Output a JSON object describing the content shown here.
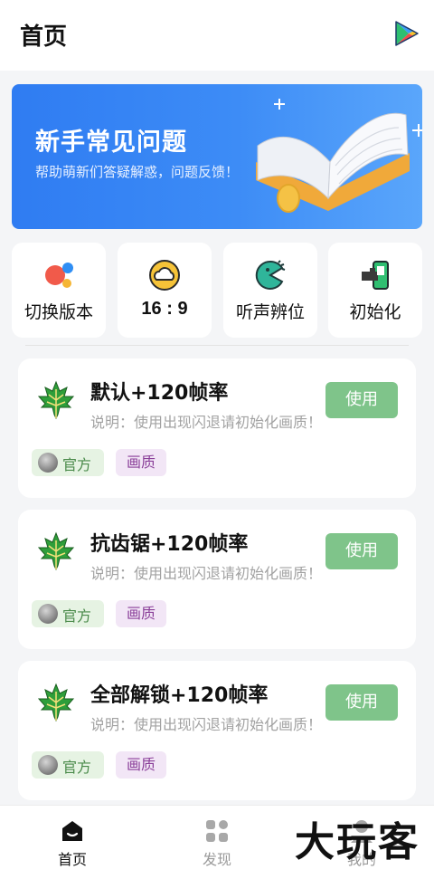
{
  "header": {
    "title": "首页",
    "store_icon": "play-store-icon"
  },
  "banner": {
    "title": "新手常见问题",
    "subtitle": "帮助萌新们答疑解惑，问题反馈！"
  },
  "quick_actions": [
    {
      "label": "切换版本",
      "icon": "switch-version-icon"
    },
    {
      "label": "16 : 9",
      "icon": "aspect-ratio-icon"
    },
    {
      "label": "听声辨位",
      "icon": "sound-position-icon"
    },
    {
      "label": "初始化",
      "icon": "initialize-icon"
    }
  ],
  "configs": [
    {
      "title": "默认+120帧率",
      "desc": "说明：使用出现闪退请初始化画质！",
      "button": "使用",
      "tag_official": "官方",
      "tag_quality": "画质"
    },
    {
      "title": "抗齿锯+120帧率",
      "desc": "说明：使用出现闪退请初始化画质！",
      "button": "使用",
      "tag_official": "官方",
      "tag_quality": "画质"
    },
    {
      "title": "全部解锁+120帧率",
      "desc": "说明：使用出现闪退请初始化画质！",
      "button": "使用",
      "tag_official": "官方",
      "tag_quality": "画质"
    }
  ],
  "bottom_nav": [
    {
      "label": "首页",
      "icon": "home-icon",
      "active": true
    },
    {
      "label": "发现",
      "icon": "discover-icon",
      "active": false
    },
    {
      "label": "我的",
      "icon": "profile-icon",
      "active": false
    }
  ],
  "watermark": "大玩客",
  "colors": {
    "accent_green": "#7fc48a",
    "banner_blue": "#2f7cf2",
    "active_nav": "#111111",
    "inactive_nav": "#9a9a9a"
  }
}
